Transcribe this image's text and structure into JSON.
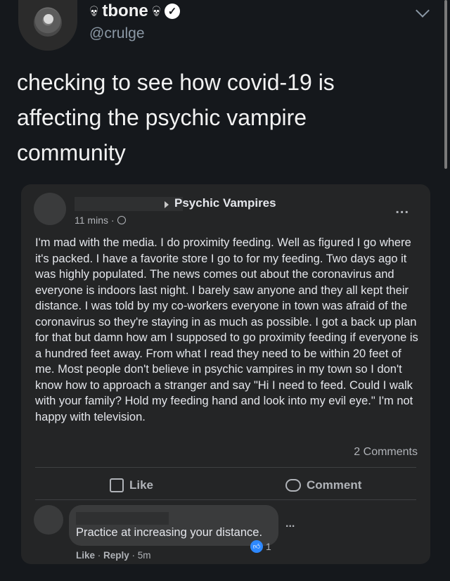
{
  "tweet": {
    "display_name": "tbone",
    "handle": "@crulge",
    "text": "checking to see how covid-19 is affecting the psychic vampire community"
  },
  "icons": {
    "skull_left": "skull-icon",
    "skull_right": "skull-icon",
    "verified": "verified-badge-icon",
    "menu": "chevron-down-icon"
  },
  "embedded_post": {
    "group": "Psychic Vampires",
    "time": "11 mins ·",
    "body": "I'm mad with the media. I do proximity feeding. Well as figured I go where it's packed. I have a favorite store I go to for my feeding. Two days ago it was highly populated. The news comes out about the coronavirus and everyone is indoors last night. I barely saw anyone and they all kept their distance. I was told by my co-workers everyone in town was afraid of the coronavirus so they're staying in as much as possible. I got a back up plan for that but damn how am I supposed to go proximity feeding if everyone is a hundred feet away. From what I read they need to be within 20 feet of me. Most people don't believe in psychic vampires in my town so I don't know how to approach a stranger and say \"Hi I need to feed. Could I walk with your family? Hold my feeding hand and look into my evil eye.\" I'm not happy with television.",
    "comments_count": "2 Comments",
    "like_label": "Like",
    "comment_label": "Comment",
    "more": "..."
  },
  "comment": {
    "text": "Practice at increasing your distance.",
    "reaction_count": "1",
    "like": "Like",
    "reply": "Reply",
    "time": "5m",
    "more": "..."
  },
  "colors": {
    "background": "#15181c",
    "card": "#242526",
    "accent": "#2d88ff"
  }
}
